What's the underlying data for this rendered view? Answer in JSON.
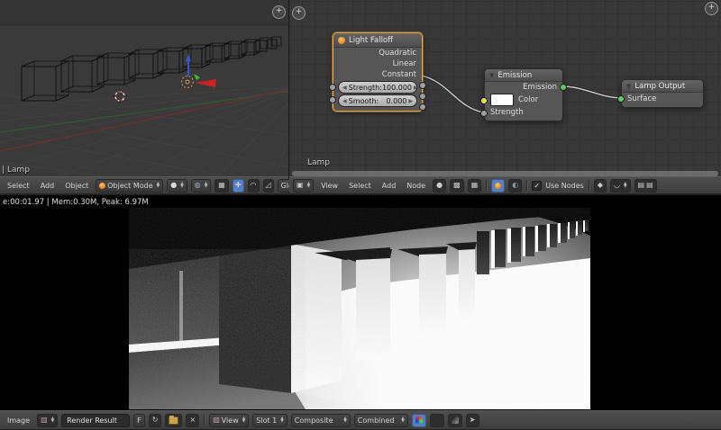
{
  "colors": {
    "accent_orange": "#e8923c",
    "node_select_orange": "#f5a33c",
    "socket_green": "#63c763",
    "socket_yellow": "#e5e549",
    "socket_gray": "#a0a0a0",
    "active_widget_blue": "#5680c2",
    "header_bg": "#454545"
  },
  "viewport3d": {
    "object_label": "| Lamp",
    "header": {
      "menu_select": "Select",
      "menu_add": "Add",
      "menu_object": "Object",
      "mode": "Object Mode",
      "orientation": "Global"
    }
  },
  "node_editor": {
    "tree_label": "Lamp",
    "header": {
      "menu_view": "View",
      "menu_select": "Select",
      "menu_add": "Add",
      "menu_node": "Node",
      "use_nodes": "Use Nodes"
    },
    "nodes": {
      "light_falloff": {
        "title": "Light Falloff",
        "out_quadratic": "Quadratic",
        "out_linear": "Linear",
        "out_constant": "Constant",
        "strength_label": "Strength:",
        "strength_value": "100.000",
        "smooth_label": "Smooth:",
        "smooth_value": "0.000"
      },
      "emission": {
        "title": "Emission",
        "out_emission": "Emission",
        "in_color": "Color",
        "in_strength": "Strength"
      },
      "lamp_output": {
        "title": "Lamp Output",
        "in_surface": "Surface"
      }
    }
  },
  "image_editor": {
    "stats": "e:00:01.97 | Mem:0.30M, Peak: 6.97M",
    "header": {
      "menu_image": "Image",
      "datablock_name": "Render Result",
      "fake_user": "F",
      "view_label": "View",
      "slot": "Slot 1",
      "render_layer": "Composite",
      "render_pass": "Combined"
    }
  }
}
